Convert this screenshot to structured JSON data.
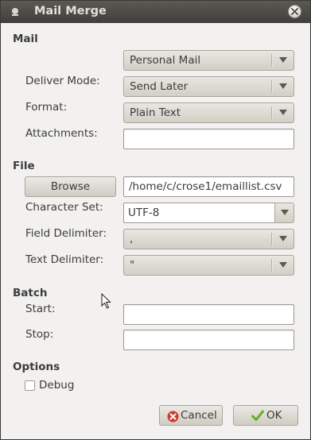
{
  "window": {
    "title": "Mail Merge"
  },
  "sections": {
    "mail": "Mail",
    "file": "File",
    "batch": "Batch",
    "options": "Options"
  },
  "mail": {
    "profile": "Personal Mail",
    "deliver_mode_label": "Deliver Mode:",
    "deliver_mode": "Send Later",
    "format_label": "Format:",
    "format": "Plain Text",
    "attachments_label": "Attachments:",
    "attachments": ""
  },
  "file": {
    "browse_label": "Browse",
    "path": "/home/c/crose1/emaillist.csv",
    "charset_label": "Character Set:",
    "charset": "UTF-8",
    "field_delim_label": "Field Delimiter:",
    "field_delim": ",",
    "text_delim_label": "Text Delimiter:",
    "text_delim": "\""
  },
  "batch": {
    "start_label": "Start:",
    "start": "",
    "stop_label": "Stop:",
    "stop": ""
  },
  "options": {
    "debug_label": "Debug",
    "debug_checked": false
  },
  "buttons": {
    "cancel": "Cancel",
    "ok": "OK"
  },
  "icons": {
    "close": "close-icon",
    "cancel": "cancel-icon",
    "ok": "checkmark-icon",
    "window": "window-menu-icon"
  },
  "colors": {
    "titlebar": "#4a4945",
    "background": "#f2f1f0",
    "cancel_icon": "#d23a2a",
    "ok_icon": "#6aae2a"
  }
}
